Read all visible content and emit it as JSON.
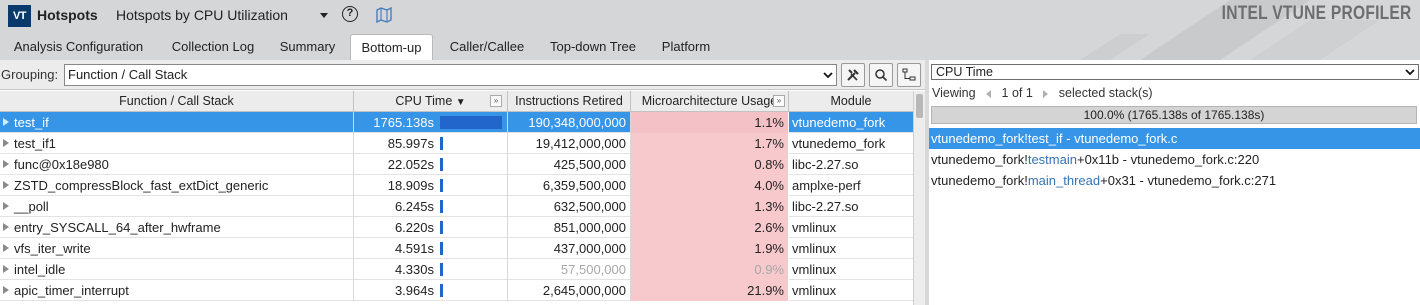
{
  "header": {
    "logo_text": "VT",
    "app_title": "Hotspots",
    "analysis_title": "Hotspots by CPU Utilization",
    "brand": "INTEL VTUNE PROFILER"
  },
  "tabs": [
    {
      "label": "Analysis Configuration",
      "active": false
    },
    {
      "label": "Collection Log",
      "active": false
    },
    {
      "label": "Summary",
      "active": false
    },
    {
      "label": "Bottom-up",
      "active": true
    },
    {
      "label": "Caller/Callee",
      "active": false
    },
    {
      "label": "Top-down Tree",
      "active": false
    },
    {
      "label": "Platform",
      "active": false
    }
  ],
  "grouping": {
    "label": "Grouping:",
    "value": "Function / Call Stack"
  },
  "columns": {
    "function": "Function / Call Stack",
    "cpu_time": "CPU Time",
    "instructions": "Instructions Retired",
    "micro": "Microarchitecture Usage",
    "module": "Module",
    "expand_glyph": "»"
  },
  "rows": [
    {
      "name": "test_if",
      "cpu_time": "1765.138s",
      "cpu_fraction": 1.0,
      "instructions": "190,348,000,000",
      "micro": "1.1%",
      "module": "vtunedemo_fork",
      "selected": true,
      "muted": false
    },
    {
      "name": "test_if1",
      "cpu_time": "85.997s",
      "cpu_fraction": 0.049,
      "instructions": "19,412,000,000",
      "micro": "1.7%",
      "module": "vtunedemo_fork",
      "selected": false,
      "muted": false
    },
    {
      "name": "func@0x18e980",
      "cpu_time": "22.052s",
      "cpu_fraction": 0.012,
      "instructions": "425,500,000",
      "micro": "0.8%",
      "module": "libc-2.27.so",
      "selected": false,
      "muted": false
    },
    {
      "name": "ZSTD_compressBlock_fast_extDict_generic",
      "cpu_time": "18.909s",
      "cpu_fraction": 0.011,
      "instructions": "6,359,500,000",
      "micro": "4.0%",
      "module": "amplxe-perf",
      "selected": false,
      "muted": false
    },
    {
      "name": "__poll",
      "cpu_time": "6.245s",
      "cpu_fraction": 0.004,
      "instructions": "632,500,000",
      "micro": "1.3%",
      "module": "libc-2.27.so",
      "selected": false,
      "muted": false
    },
    {
      "name": "entry_SYSCALL_64_after_hwframe",
      "cpu_time": "6.220s",
      "cpu_fraction": 0.004,
      "instructions": "851,000,000",
      "micro": "2.6%",
      "module": "vmlinux",
      "selected": false,
      "muted": false
    },
    {
      "name": "vfs_iter_write",
      "cpu_time": "4.591s",
      "cpu_fraction": 0.003,
      "instructions": "437,000,000",
      "micro": "1.9%",
      "module": "vmlinux",
      "selected": false,
      "muted": false
    },
    {
      "name": "intel_idle",
      "cpu_time": "4.330s",
      "cpu_fraction": 0.002,
      "instructions": "57,500,000",
      "micro": "0.9%",
      "module": "vmlinux",
      "selected": false,
      "muted": true
    },
    {
      "name": "apic_timer_interrupt",
      "cpu_time": "3.964s",
      "cpu_fraction": 0.002,
      "instructions": "2,645,000,000",
      "micro": "21.9%",
      "module": "vmlinux",
      "selected": false,
      "muted": false
    }
  ],
  "right_pane": {
    "metric": "CPU Time",
    "viewing_label": "Viewing",
    "pager_text": "1 of 1",
    "selected_stacks": "selected stack(s)",
    "percentage_text": "100.0% (1765.138s of 1765.138s)",
    "frames": [
      {
        "prefix": "vtunedemo_fork!",
        "function": "test_if",
        "suffix": " - vtunedemo_fork.c",
        "selected": true
      },
      {
        "prefix": "vtunedemo_fork!",
        "function": "testmain",
        "suffix": "+0x11b - vtunedemo_fork.c:220",
        "selected": false
      },
      {
        "prefix": "vtunedemo_fork!",
        "function": "main_thread",
        "suffix": "+0x31 - vtunedemo_fork.c:271",
        "selected": false
      }
    ]
  },
  "colors": {
    "selection": "#3795e8",
    "cpu_bar": "#2266cc",
    "micro_cell": "#f7c8cc",
    "function_link": "#3474b8"
  }
}
